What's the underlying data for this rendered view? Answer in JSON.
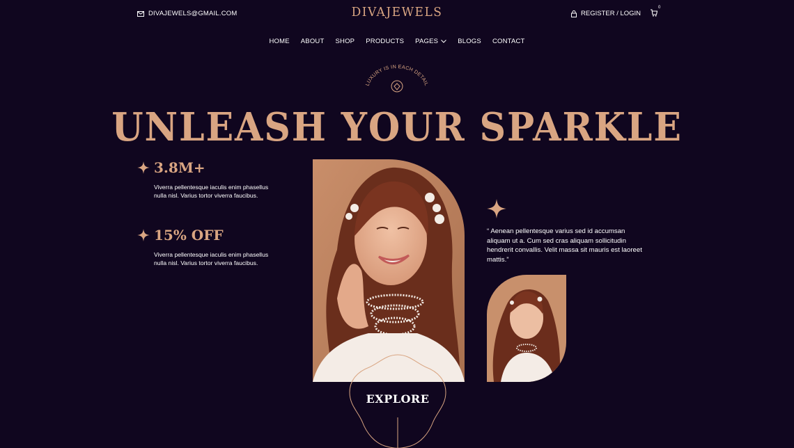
{
  "topbar": {
    "email": "DIVAJEWELS@GMAIL.COM",
    "auth": "REGISTER / LOGIN",
    "cart_count": "0"
  },
  "brand": {
    "logo": "DIVAJEWELS"
  },
  "nav": {
    "items": [
      {
        "label": "HOME"
      },
      {
        "label": "ABOUT"
      },
      {
        "label": "SHOP"
      },
      {
        "label": "PRODUCTS"
      },
      {
        "label": "PAGES"
      },
      {
        "label": "BLOGS"
      },
      {
        "label": "CONTACT"
      }
    ]
  },
  "hero": {
    "badge_text": "LUXURY IS IN EACH DETAIL",
    "headline": "UNLEASH YOUR SPARKLE",
    "stats": [
      {
        "value": "3.8M+",
        "text": "Viverra pellentesque iaculis enim phasellus nulla nisl. Varius tortor viverra faucibus."
      },
      {
        "value": "15% OFF",
        "text": "Viverra pellentesque iaculis enim phasellus nulla nisl. Varius tortor viverra faucibus."
      }
    ],
    "quote": "“ Aenean pellentesque varius sed id accumsan aliquam ut a. Cum sed cras aliquam sollicitudin hendrerit convallis. Velit massa sit mauris est laoreet mattis.”",
    "cta": "EXPLORE"
  },
  "colors": {
    "background": "#10061f",
    "accent": "#d9a582"
  }
}
